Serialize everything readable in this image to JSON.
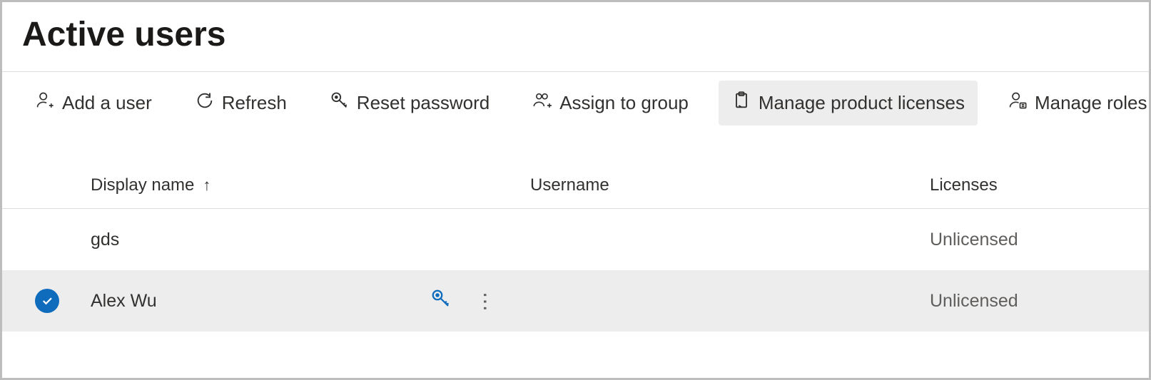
{
  "page": {
    "title": "Active users"
  },
  "toolbar": {
    "add_user": "Add a user",
    "refresh": "Refresh",
    "reset_password": "Reset password",
    "assign_group": "Assign to group",
    "manage_licenses": "Manage product licenses",
    "manage_roles": "Manage roles"
  },
  "columns": {
    "display_name": "Display name",
    "username": "Username",
    "licenses": "Licenses"
  },
  "rows": [
    {
      "name": "gds",
      "username": "",
      "license": "Unlicensed",
      "selected": false
    },
    {
      "name": "Alex Wu",
      "username": "",
      "license": "Unlicensed",
      "selected": true
    }
  ]
}
